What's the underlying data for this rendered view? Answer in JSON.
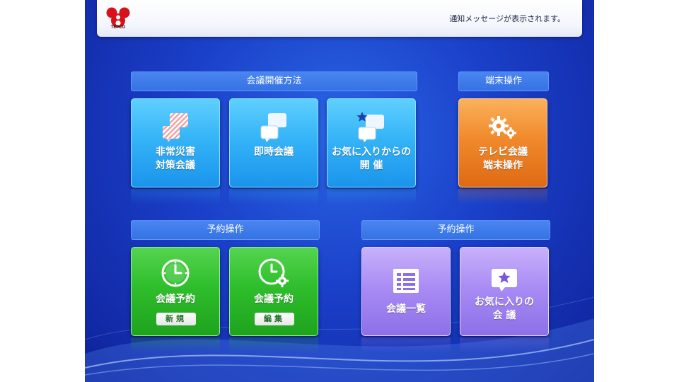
{
  "header": {
    "logo_text": "TEPCO",
    "notice": "通知メッセージが表示されます。"
  },
  "sections": {
    "meeting_method": "会議開催方法",
    "terminal_ops": "端末操作",
    "reservation_ops_left": "予約操作",
    "reservation_ops_right": "予約操作"
  },
  "tiles": {
    "disaster": {
      "label": "非常災害\n対策会議",
      "icon": "chat-bubbles-striped-icon"
    },
    "instant": {
      "label": "即時会議",
      "icon": "chat-bubbles-icon"
    },
    "favorites_start": {
      "label": "お気に入りからの\n開 催",
      "icon": "star-chat-bubbles-icon"
    },
    "tv_terminal": {
      "label": "テレビ会議\n端末操作",
      "icon": "gears-icon"
    },
    "reserve_new": {
      "label": "会議予約",
      "sub": "新規",
      "icon": "clock-icon"
    },
    "reserve_edit": {
      "label": "会議予約",
      "sub": "編集",
      "icon": "clock-gear-icon"
    },
    "meeting_list": {
      "label": "会議一覧",
      "icon": "list-icon"
    },
    "favorite_meetings": {
      "label": "お気に入りの\n会 議",
      "icon": "star-message-icon"
    }
  },
  "colors": {
    "background": "#1a3fc8",
    "tile_blue": "#35b4f7",
    "tile_orange": "#f08a2c",
    "tile_green": "#2fbe2c",
    "tile_purple": "#a98cf4"
  }
}
